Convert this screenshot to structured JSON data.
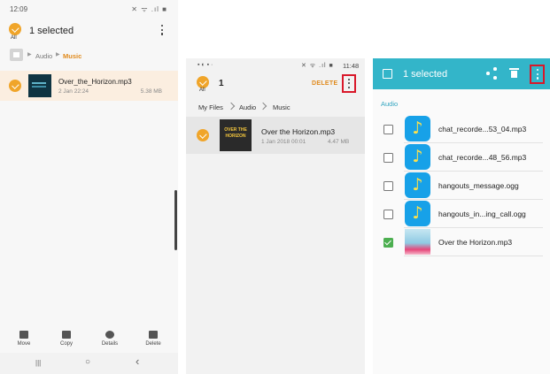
{
  "panel1": {
    "status_time": "12:09",
    "status_icons": "✕ ᯤ .ıl ■",
    "all_label": "All",
    "selected_text": "1 selected",
    "breadcrumb": [
      "Audio",
      "Music"
    ],
    "file": {
      "name": "Over_the_Horizon.mp3",
      "date": "2 Jan 22:24",
      "size": "5.38 MB"
    },
    "actions": [
      "Move",
      "Copy",
      "Details",
      "Delete"
    ],
    "nav": [
      "|||",
      "○",
      "‹"
    ]
  },
  "panel2": {
    "status_left": "▪ ◐ ▪ ·",
    "status_right": "✕ ᯤ .ıl ■",
    "status_time": "11:48",
    "all_label": "All",
    "count": "1",
    "delete_label": "DELETE",
    "breadcrumb": [
      "My Files",
      "Audio",
      "Music"
    ],
    "thumb_text": "OVER THE HORIZON",
    "file": {
      "name": "Over the Horizon.mp3",
      "date": "1 Jan 2018 00:01",
      "size": "4.47 MB"
    }
  },
  "panel3": {
    "title": "1 selected",
    "section": "Audio",
    "items": [
      {
        "name": "chat_recorde...53_04.mp3",
        "checked": false,
        "icon": "music-note-icon"
      },
      {
        "name": "chat_recorde...48_56.mp3",
        "checked": false,
        "icon": "music-note-icon"
      },
      {
        "name": "hangouts_message.ogg",
        "checked": false,
        "icon": "music-note-icon"
      },
      {
        "name": "hangouts_in...ing_call.ogg",
        "checked": false,
        "icon": "music-note-icon"
      },
      {
        "name": "Over the Horizon.mp3",
        "checked": true,
        "icon": "album-art-thumbnail"
      }
    ],
    "icon_glyph": "♪"
  },
  "colors": {
    "accent_orange": "#f0a52a",
    "teal": "#33b5c9",
    "highlight_red": "#d9182a",
    "check_green": "#4caf50"
  }
}
